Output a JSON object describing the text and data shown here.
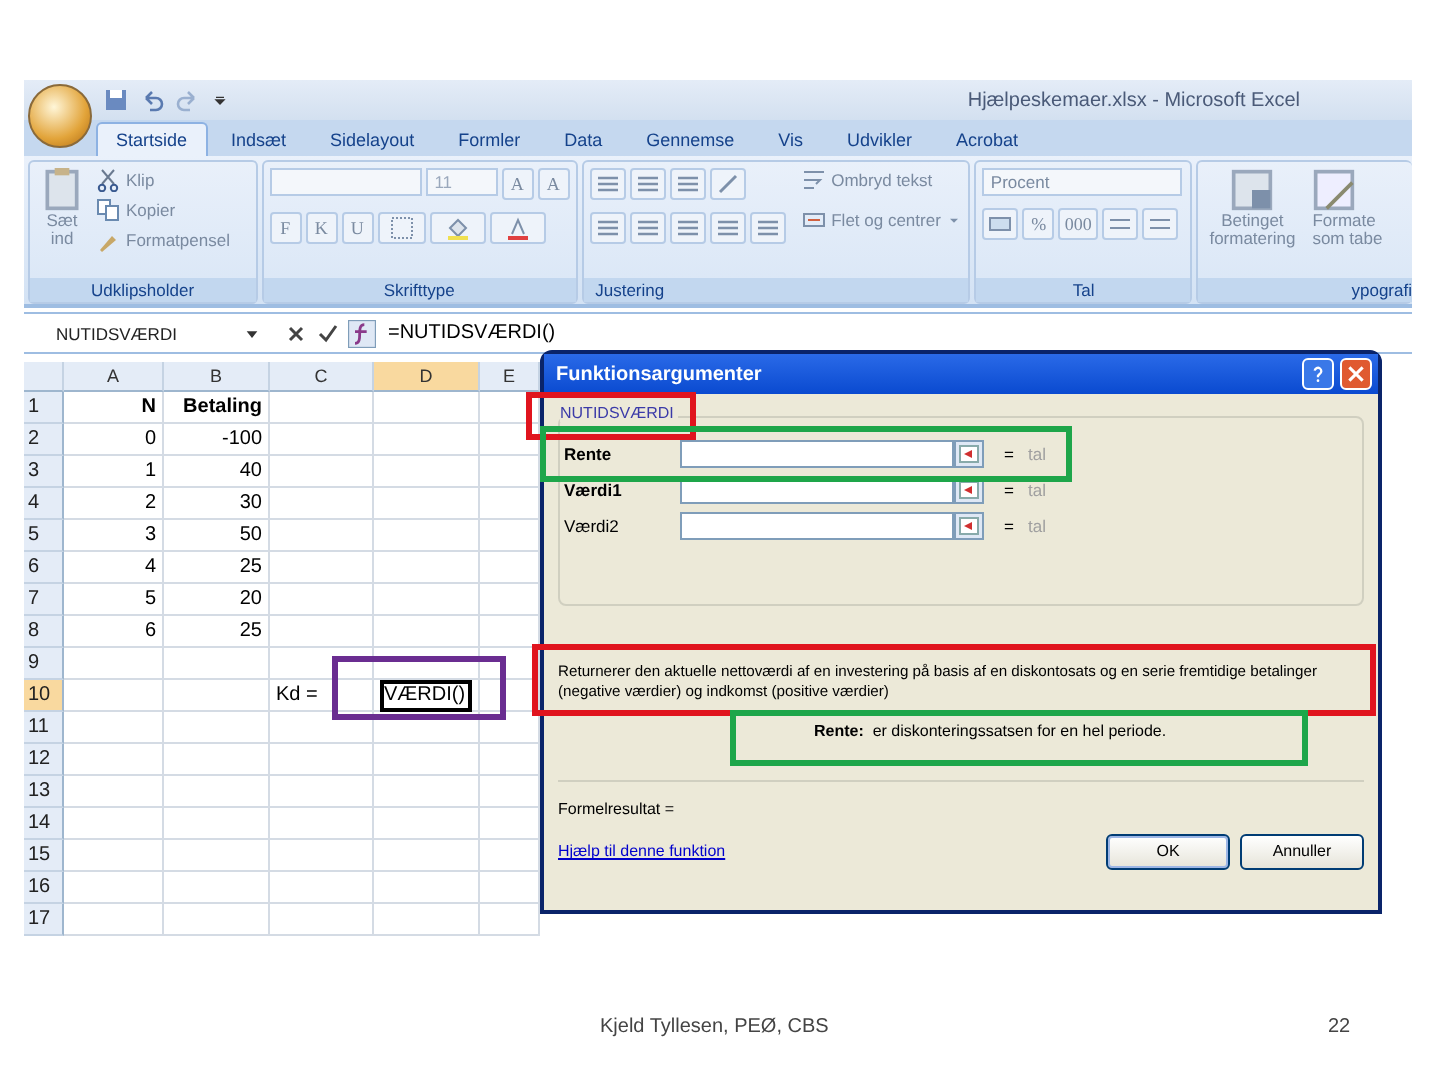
{
  "window": {
    "title": "Hjælpeskemaer.xlsx - Microsoft Excel"
  },
  "ribbon_tabs": [
    {
      "label": "Startside",
      "selected": true
    },
    {
      "label": "Indsæt",
      "selected": false
    },
    {
      "label": "Sidelayout",
      "selected": false
    },
    {
      "label": "Formler",
      "selected": false
    },
    {
      "label": "Data",
      "selected": false
    },
    {
      "label": "Gennemse",
      "selected": false
    },
    {
      "label": "Vis",
      "selected": false
    },
    {
      "label": "Udvikler",
      "selected": false
    },
    {
      "label": "Acrobat",
      "selected": false
    }
  ],
  "ribbon": {
    "clipboard": {
      "label": "Udklipsholder",
      "paste": "Sæt ind",
      "cut": "Klip",
      "copy": "Kopier",
      "format_painter": "Formatpensel"
    },
    "font": {
      "label": "Skrifttype",
      "size": "11",
      "grow": "A",
      "shrink": "A",
      "bold": "F",
      "italic": "K",
      "underline": "U"
    },
    "alignment": {
      "label": "Justering",
      "wrap": "Ombryd tekst",
      "merge": "Flet og centrer"
    },
    "number": {
      "label": "Tal",
      "format": "Procent",
      "percent": "%",
      "thousands": "000"
    },
    "styles": {
      "label": "ypografi",
      "conditional": [
        "Betinget",
        "formatering"
      ],
      "as_table": [
        "Formate",
        "som tabe"
      ]
    }
  },
  "formula_bar": {
    "name_box": "NUTIDSVÆRDI",
    "formula": "=NUTIDSVÆRDI()"
  },
  "sheet": {
    "columns": [
      {
        "label": "A",
        "selected": false
      },
      {
        "label": "B",
        "selected": false
      },
      {
        "label": "C",
        "selected": false
      },
      {
        "label": "D",
        "selected": true
      },
      {
        "label": "E",
        "selected": false
      }
    ],
    "rows": [
      {
        "label": "1",
        "selected": false,
        "kind": "header",
        "a": "N",
        "b": "Betaling"
      },
      {
        "label": "2",
        "selected": false,
        "kind": "data",
        "a": "0",
        "b": "-100"
      },
      {
        "label": "3",
        "selected": false,
        "kind": "data",
        "a": "1",
        "b": "40"
      },
      {
        "label": "4",
        "selected": false,
        "kind": "data",
        "a": "2",
        "b": "30"
      },
      {
        "label": "5",
        "selected": false,
        "kind": "data",
        "a": "3",
        "b": "50"
      },
      {
        "label": "6",
        "selected": false,
        "kind": "data",
        "a": "4",
        "b": "25"
      },
      {
        "label": "7",
        "selected": false,
        "kind": "data",
        "a": "5",
        "b": "20"
      },
      {
        "label": "8",
        "selected": false,
        "kind": "data",
        "a": "6",
        "b": "25"
      },
      {
        "label": "9",
        "selected": false,
        "kind": "empty"
      },
      {
        "label": "10",
        "selected": true,
        "kind": "input",
        "c": "Kd =",
        "d": "VÆRDI()"
      },
      {
        "label": "11",
        "selected": false,
        "kind": "empty"
      },
      {
        "label": "12",
        "selected": false,
        "kind": "empty"
      },
      {
        "label": "13",
        "selected": false,
        "kind": "empty"
      },
      {
        "label": "14",
        "selected": false,
        "kind": "empty"
      },
      {
        "label": "15",
        "selected": false,
        "kind": "empty"
      },
      {
        "label": "16",
        "selected": false,
        "kind": "empty"
      },
      {
        "label": "17",
        "selected": false,
        "kind": "empty"
      }
    ]
  },
  "dialog": {
    "title": "Funktionsargumenter",
    "function_name": "NUTIDSVÆRDI",
    "arguments": [
      {
        "name": "Rente",
        "required": true,
        "equals": "=",
        "result": "tal"
      },
      {
        "name": "Værdi1",
        "required": true,
        "equals": "=",
        "result": "tal"
      },
      {
        "name": "Værdi2",
        "required": false,
        "equals": "=",
        "result": "tal"
      }
    ],
    "description": "Returnerer den aktuelle nettoværdi af en investering på basis af en diskontosats og en serie fremtidige betalinger (negative værdier) og indkomst (positive værdier)",
    "argument_help": {
      "name": "Rente:",
      "text": "er diskonteringssatsen for en hel periode."
    },
    "result_label": "Formelresultat =",
    "help_link": "Hjælp til denne funktion",
    "buttons": [
      {
        "label": "OK",
        "default": true
      },
      {
        "label": "Annuller",
        "default": false
      }
    ]
  },
  "footer": {
    "author": "Kjeld Tyllesen, PEØ, CBS",
    "page": "22"
  }
}
